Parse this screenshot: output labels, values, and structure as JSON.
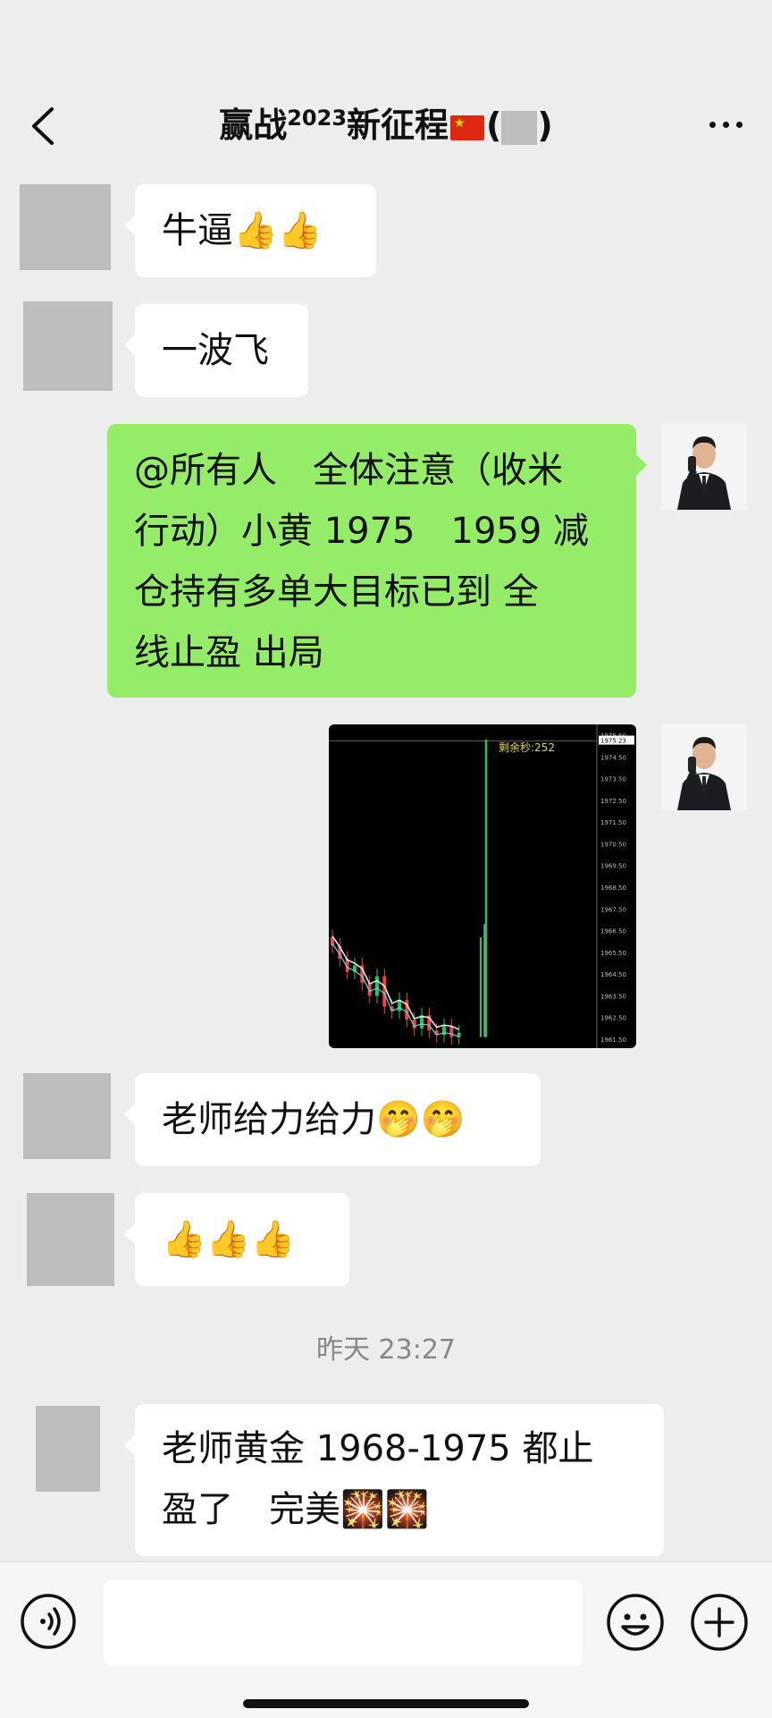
{
  "header": {
    "title_prefix": "赢战",
    "title_sup": "2023",
    "title_main": "新征程",
    "title_open": "(",
    "title_close": ")"
  },
  "messages": [
    {
      "from": "other",
      "text": "牛逼👍👍"
    },
    {
      "from": "other",
      "text": "一波飞"
    },
    {
      "from": "me",
      "lines": [
        "@所有人　全体注意（收米",
        "行动）小黄 1975　1959 减",
        "仓持有多单大目标已到 全",
        "线止盈 出局"
      ]
    },
    {
      "from": "me",
      "type": "image"
    },
    {
      "from": "other",
      "text": "老师给力给力🤭🤭"
    },
    {
      "from": "other",
      "text": "👍👍👍"
    },
    {
      "from": "other",
      "lines": [
        "老师黄金 1968-1975 都止",
        "盈了　完美🎇🎇"
      ]
    }
  ],
  "timestamp": "昨天 23:27",
  "chart_data": {
    "type": "line",
    "title": "",
    "overlay_text": "剩余秒:252",
    "current_price_label": "1975.23",
    "ylim": [
      1961.5,
      1975.5
    ],
    "y_ticks": [
      "1975.50",
      "1974.50",
      "1973.50",
      "1972.50",
      "1971.50",
      "1970.50",
      "1969.50",
      "1968.50",
      "1967.50",
      "1966.50",
      "1965.50",
      "1964.50",
      "1963.50",
      "1962.50",
      "1961.50"
    ],
    "candles_approx_close": [
      1965.8,
      1965.2,
      1964.6,
      1964.9,
      1964.1,
      1963.5,
      1964.4,
      1963.0,
      1962.8,
      1963.3,
      1962.4,
      1962.0,
      1962.6,
      1961.9,
      1961.7,
      1962.1,
      1961.6,
      1961.8,
      1975.3
    ],
    "colors": {
      "up": "#22c55e",
      "down": "#ef4444",
      "ma": "#e5f7ff",
      "ma2": "#5ad6e6",
      "overlay": "#e6d84a"
    }
  },
  "bottom_bar": {
    "voice_icon": "voice-icon",
    "emoji_icon": "emoji-icon",
    "plus_icon": "plus-icon"
  }
}
